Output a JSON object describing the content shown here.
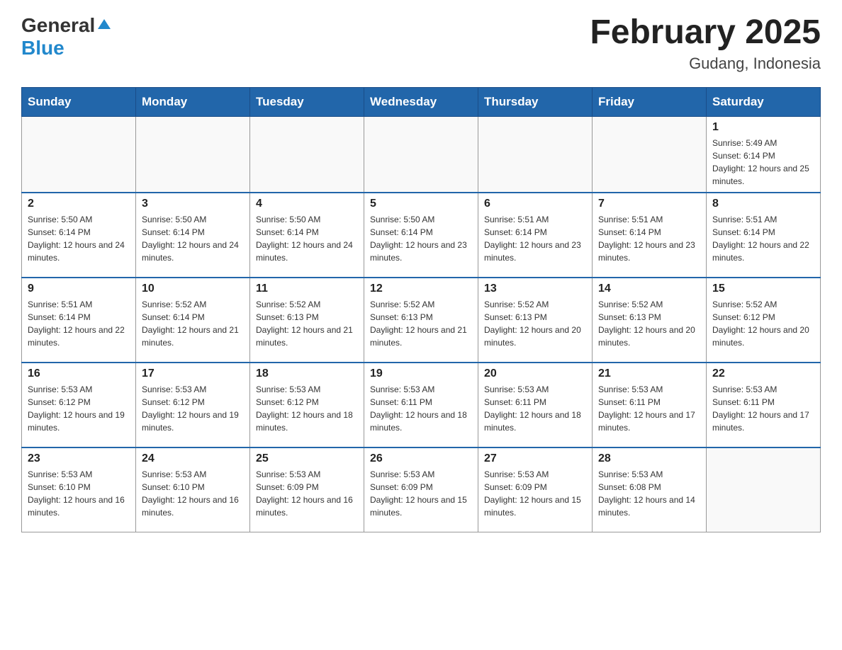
{
  "header": {
    "logo_general": "General",
    "logo_blue": "Blue",
    "month_title": "February 2025",
    "location": "Gudang, Indonesia"
  },
  "weekdays": [
    "Sunday",
    "Monday",
    "Tuesday",
    "Wednesday",
    "Thursday",
    "Friday",
    "Saturday"
  ],
  "weeks": [
    [
      {
        "day": "",
        "info": ""
      },
      {
        "day": "",
        "info": ""
      },
      {
        "day": "",
        "info": ""
      },
      {
        "day": "",
        "info": ""
      },
      {
        "day": "",
        "info": ""
      },
      {
        "day": "",
        "info": ""
      },
      {
        "day": "1",
        "info": "Sunrise: 5:49 AM\nSunset: 6:14 PM\nDaylight: 12 hours and 25 minutes."
      }
    ],
    [
      {
        "day": "2",
        "info": "Sunrise: 5:50 AM\nSunset: 6:14 PM\nDaylight: 12 hours and 24 minutes."
      },
      {
        "day": "3",
        "info": "Sunrise: 5:50 AM\nSunset: 6:14 PM\nDaylight: 12 hours and 24 minutes."
      },
      {
        "day": "4",
        "info": "Sunrise: 5:50 AM\nSunset: 6:14 PM\nDaylight: 12 hours and 24 minutes."
      },
      {
        "day": "5",
        "info": "Sunrise: 5:50 AM\nSunset: 6:14 PM\nDaylight: 12 hours and 23 minutes."
      },
      {
        "day": "6",
        "info": "Sunrise: 5:51 AM\nSunset: 6:14 PM\nDaylight: 12 hours and 23 minutes."
      },
      {
        "day": "7",
        "info": "Sunrise: 5:51 AM\nSunset: 6:14 PM\nDaylight: 12 hours and 23 minutes."
      },
      {
        "day": "8",
        "info": "Sunrise: 5:51 AM\nSunset: 6:14 PM\nDaylight: 12 hours and 22 minutes."
      }
    ],
    [
      {
        "day": "9",
        "info": "Sunrise: 5:51 AM\nSunset: 6:14 PM\nDaylight: 12 hours and 22 minutes."
      },
      {
        "day": "10",
        "info": "Sunrise: 5:52 AM\nSunset: 6:14 PM\nDaylight: 12 hours and 21 minutes."
      },
      {
        "day": "11",
        "info": "Sunrise: 5:52 AM\nSunset: 6:13 PM\nDaylight: 12 hours and 21 minutes."
      },
      {
        "day": "12",
        "info": "Sunrise: 5:52 AM\nSunset: 6:13 PM\nDaylight: 12 hours and 21 minutes."
      },
      {
        "day": "13",
        "info": "Sunrise: 5:52 AM\nSunset: 6:13 PM\nDaylight: 12 hours and 20 minutes."
      },
      {
        "day": "14",
        "info": "Sunrise: 5:52 AM\nSunset: 6:13 PM\nDaylight: 12 hours and 20 minutes."
      },
      {
        "day": "15",
        "info": "Sunrise: 5:52 AM\nSunset: 6:12 PM\nDaylight: 12 hours and 20 minutes."
      }
    ],
    [
      {
        "day": "16",
        "info": "Sunrise: 5:53 AM\nSunset: 6:12 PM\nDaylight: 12 hours and 19 minutes."
      },
      {
        "day": "17",
        "info": "Sunrise: 5:53 AM\nSunset: 6:12 PM\nDaylight: 12 hours and 19 minutes."
      },
      {
        "day": "18",
        "info": "Sunrise: 5:53 AM\nSunset: 6:12 PM\nDaylight: 12 hours and 18 minutes."
      },
      {
        "day": "19",
        "info": "Sunrise: 5:53 AM\nSunset: 6:11 PM\nDaylight: 12 hours and 18 minutes."
      },
      {
        "day": "20",
        "info": "Sunrise: 5:53 AM\nSunset: 6:11 PM\nDaylight: 12 hours and 18 minutes."
      },
      {
        "day": "21",
        "info": "Sunrise: 5:53 AM\nSunset: 6:11 PM\nDaylight: 12 hours and 17 minutes."
      },
      {
        "day": "22",
        "info": "Sunrise: 5:53 AM\nSunset: 6:11 PM\nDaylight: 12 hours and 17 minutes."
      }
    ],
    [
      {
        "day": "23",
        "info": "Sunrise: 5:53 AM\nSunset: 6:10 PM\nDaylight: 12 hours and 16 minutes."
      },
      {
        "day": "24",
        "info": "Sunrise: 5:53 AM\nSunset: 6:10 PM\nDaylight: 12 hours and 16 minutes."
      },
      {
        "day": "25",
        "info": "Sunrise: 5:53 AM\nSunset: 6:09 PM\nDaylight: 12 hours and 16 minutes."
      },
      {
        "day": "26",
        "info": "Sunrise: 5:53 AM\nSunset: 6:09 PM\nDaylight: 12 hours and 15 minutes."
      },
      {
        "day": "27",
        "info": "Sunrise: 5:53 AM\nSunset: 6:09 PM\nDaylight: 12 hours and 15 minutes."
      },
      {
        "day": "28",
        "info": "Sunrise: 5:53 AM\nSunset: 6:08 PM\nDaylight: 12 hours and 14 minutes."
      },
      {
        "day": "",
        "info": ""
      }
    ]
  ]
}
